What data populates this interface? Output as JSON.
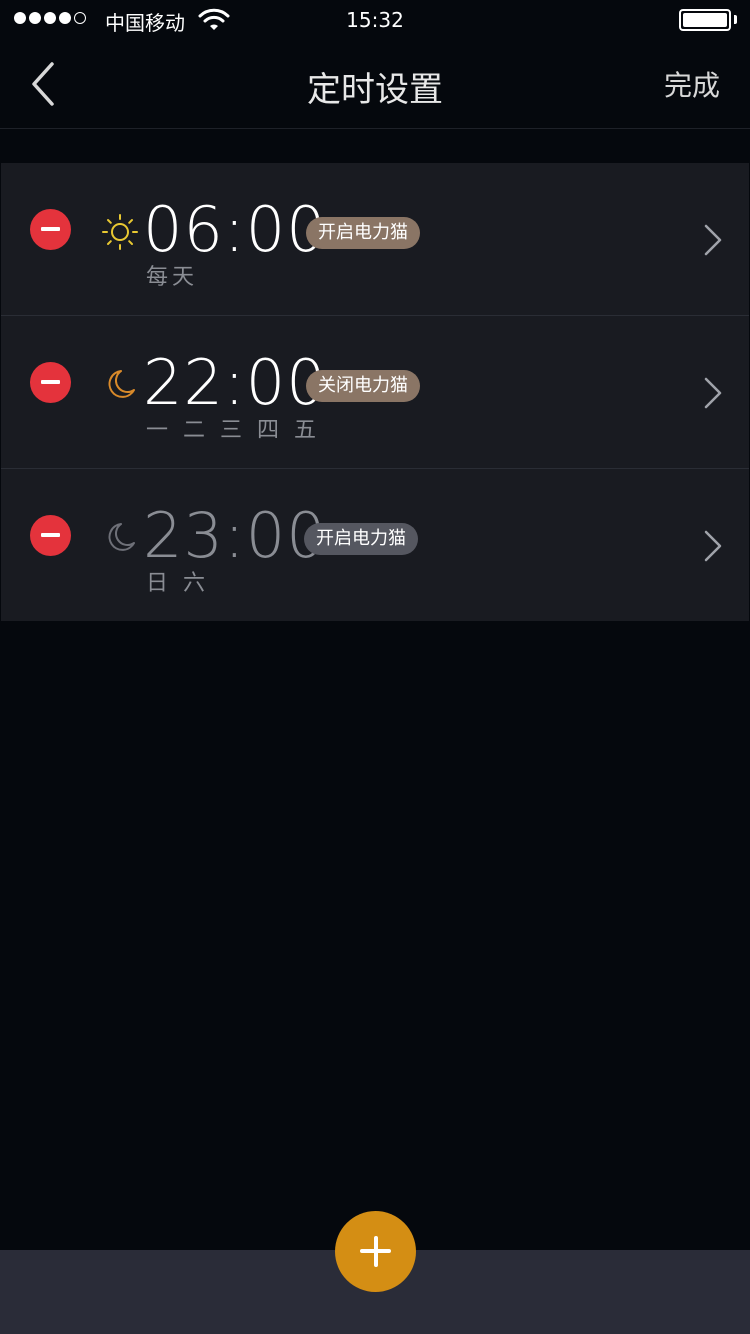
{
  "status_bar": {
    "carrier": "中国移动",
    "time": "15:32",
    "signal_strength": 4,
    "signal_max": 5
  },
  "nav": {
    "title": "定时设置",
    "done_label": "完成",
    "back_icon": "chevron-left-icon"
  },
  "colors": {
    "background": "#05080d",
    "row_background": "#191b21",
    "delete_red": "#e4333c",
    "accent_orange": "#d48e14",
    "badge_brown": "#8a7565",
    "badge_gray": "#555760",
    "sun_yellow": "#e8c832",
    "moon_orange": "#d98a2a",
    "moon_gray": "#6e7078"
  },
  "schedules": [
    {
      "time": "06:00",
      "days": "每天",
      "action": "开启电力猫",
      "icon": "sun-icon",
      "enabled": true
    },
    {
      "time": "22:00",
      "days": "一 二 三 四 五",
      "action": "关闭电力猫",
      "icon": "moon-icon",
      "enabled": true
    },
    {
      "time": "23:00",
      "days": "日 六",
      "action": "开启电力猫",
      "icon": "moon-icon",
      "enabled": false
    }
  ],
  "add_button_icon": "plus-icon"
}
